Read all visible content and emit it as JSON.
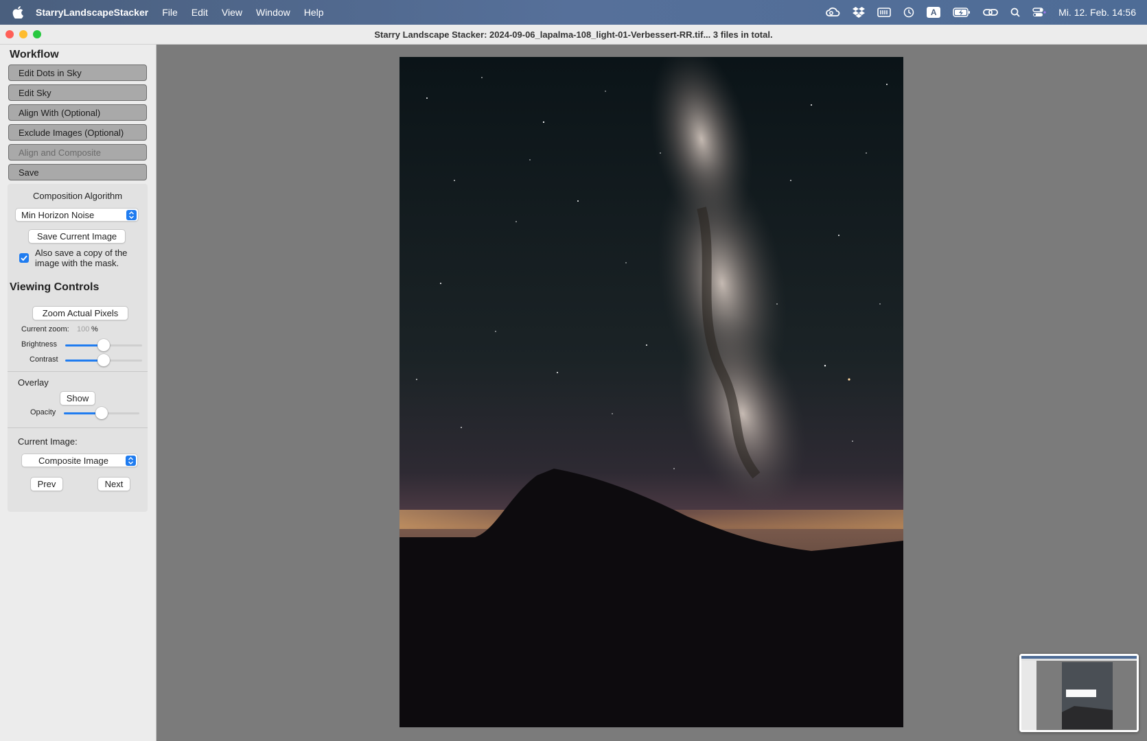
{
  "menubar": {
    "app_name": "StarryLandscapeStacker",
    "items": [
      "File",
      "Edit",
      "View",
      "Window",
      "Help"
    ],
    "status_icons": [
      "creative-cloud-icon",
      "dropbox-icon",
      "memory-icon",
      "time-machine-icon",
      "input-source-icon",
      "battery-icon",
      "link-icon",
      "spotlight-search-icon",
      "control-center-icon"
    ],
    "input_source_letter": "A",
    "clock": "Mi. 12. Feb.  14:56"
  },
  "window": {
    "title": "Starry Landscape Stacker: 2024-09-06_lapalma-108_light-01-Verbessert-RR.tif...  3 files in total."
  },
  "workflow": {
    "heading": "Workflow",
    "buttons": [
      {
        "label": "Edit Dots in Sky",
        "enabled": true
      },
      {
        "label": "Edit Sky",
        "enabled": true
      },
      {
        "label": "Align With (Optional)",
        "enabled": true
      },
      {
        "label": "Exclude Images (Optional)",
        "enabled": true
      },
      {
        "label": "Align and Composite",
        "enabled": false
      },
      {
        "label": "Save",
        "enabled": true
      }
    ],
    "composition_label": "Composition Algorithm",
    "composition_value": "Min Horizon Noise",
    "save_current_label": "Save Current Image",
    "mask_checkbox_label": "Also save a copy of the image with the mask.",
    "mask_checked": true
  },
  "viewing": {
    "heading": "Viewing Controls",
    "zoom_button": "Zoom Actual Pixels",
    "zoom_label": "Current zoom:",
    "zoom_value": "100",
    "zoom_unit": "%",
    "brightness_label": "Brightness",
    "brightness_value": 0.5,
    "contrast_label": "Contrast",
    "contrast_value": 0.5
  },
  "overlay": {
    "heading": "Overlay",
    "show_button": "Show",
    "opacity_label": "Opacity",
    "opacity_value": 0.5
  },
  "current_image": {
    "label": "Current Image:",
    "value": "Composite Image",
    "prev": "Prev",
    "next": "Next"
  },
  "colors": {
    "accent": "#1f7cf0",
    "close": "#ff5f57",
    "minimize": "#febc2e",
    "zoom": "#28c840"
  }
}
